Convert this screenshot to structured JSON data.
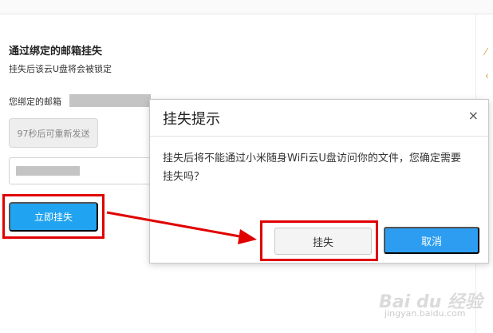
{
  "section": {
    "title": "通过绑定的邮箱挂失",
    "subtitle": "挂失后该云U盘将会被锁定",
    "email_label": "您绑定的邮箱",
    "resend_label": "97秒后可重新发送",
    "report_label": "立即挂失"
  },
  "dialog": {
    "title": "挂失提示",
    "close_glyph": "×",
    "message": "挂失后将不能通过小米随身WiFi云U盘访问你的文件，您确定需要挂失吗？",
    "confirm_label": "挂失",
    "cancel_label": "取消"
  },
  "watermark": {
    "brand": "Bai du 经验",
    "url": "jingyan.baidu.com"
  },
  "colors": {
    "primary_button": "#20a3f0",
    "highlight": "#e00000"
  }
}
